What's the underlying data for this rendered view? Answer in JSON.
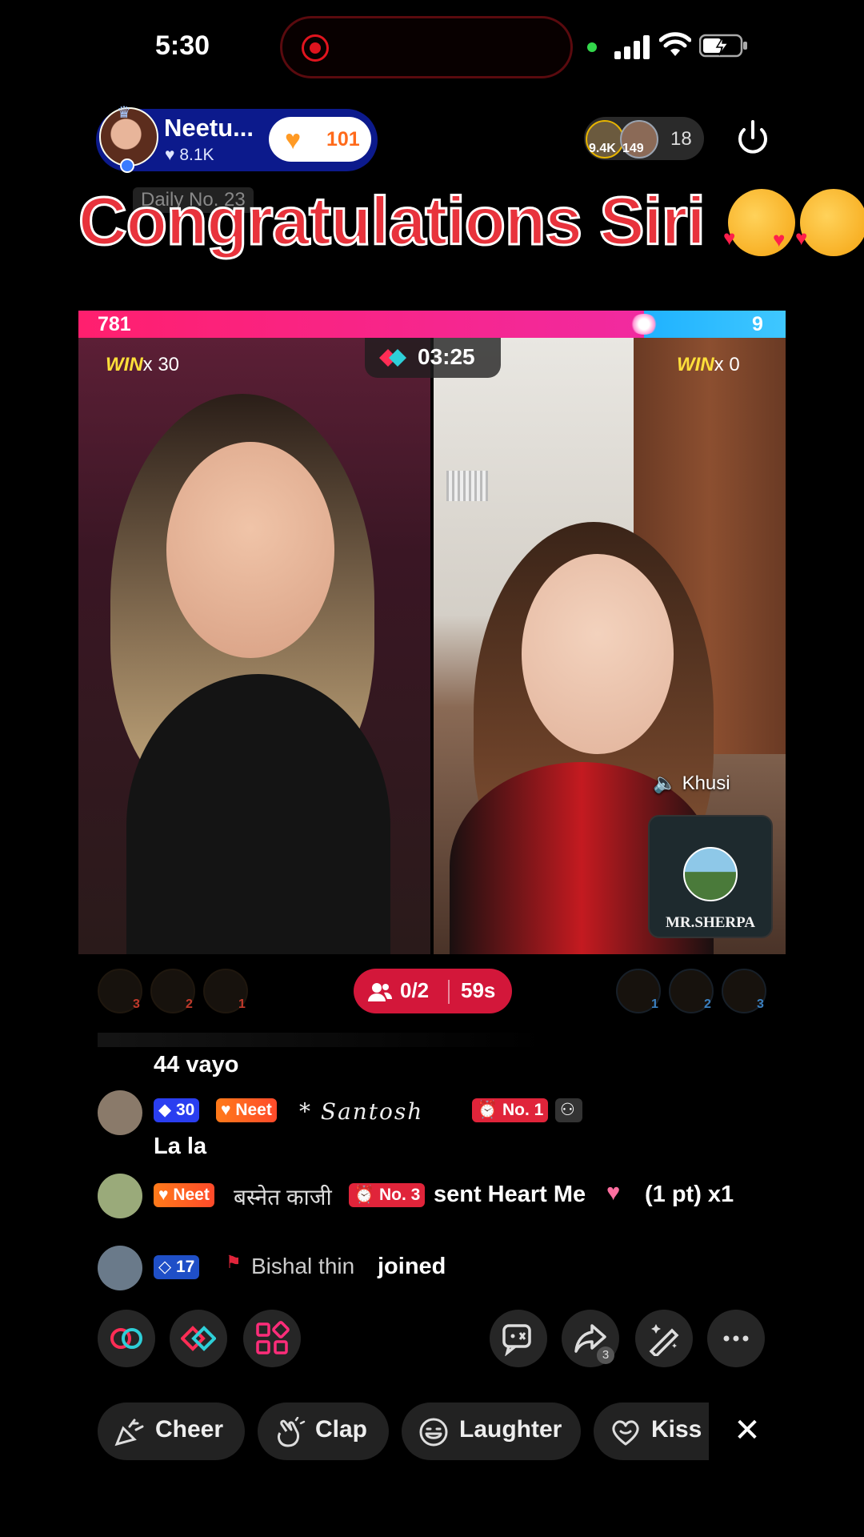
{
  "status_bar": {
    "time": "5:30"
  },
  "host": {
    "name": "Neetu...",
    "likes": "8.1K",
    "follow_count": "101"
  },
  "viewers": {
    "avatar1_count": "9.4K",
    "avatar2_count": "149",
    "total": "18"
  },
  "overlay": {
    "daily_label": "Daily No. 23",
    "congrats_text": "Congratulations Siri"
  },
  "battle": {
    "score_left": "781",
    "score_right": "9",
    "timer": "03:25",
    "left_win_label": "WIN",
    "left_win_count": "x 30",
    "right_win_label": "WIN",
    "right_win_count": "x 0",
    "right_mic_label": "Khusi",
    "guest_name": "MR.SHERPA",
    "progress_left_fraction": 0.8
  },
  "contributors": {
    "left_ranks": [
      "3",
      "2",
      "1"
    ],
    "right_ranks": [
      "1",
      "2",
      "3"
    ],
    "mic_seats": "0/2",
    "mic_time": "59s"
  },
  "chat": [
    {
      "id": "c1",
      "text": "44 vayo"
    },
    {
      "id": "c2",
      "level": "30",
      "fan_badge": "Neet",
      "user": "* Santosh",
      "rank_badge": "No. 1",
      "text": "La la"
    },
    {
      "id": "c3",
      "fan_badge": "Neet",
      "user": "बस्नेत काजी",
      "rank_badge": "No. 3",
      "text": "sent Heart Me",
      "gift_suffix": "(1 pt) x1"
    },
    {
      "id": "c4",
      "level": "17",
      "user": "Bishal thin",
      "text": "joined"
    }
  ],
  "reactions": [
    {
      "label": "Cheer"
    },
    {
      "label": "Clap"
    },
    {
      "label": "Laughter"
    },
    {
      "label": "Kiss"
    }
  ],
  "colors": {
    "accent_pink": "#ff1f6e",
    "accent_blue": "#1fb2ff",
    "congrats_red": "#e8333c",
    "win_yellow": "#ffdf3a",
    "mic_pill_red": "#d3173a"
  },
  "icons": [
    "record-icon",
    "signal-icon",
    "wifi-icon",
    "battery-icon",
    "power-icon",
    "heart-icon",
    "link-icon",
    "pk-icon",
    "apps-icon",
    "chat-icon",
    "share-icon",
    "magic-wand-icon",
    "more-icon",
    "cheer-icon",
    "clap-icon",
    "laughter-icon",
    "kiss-icon",
    "close-icon"
  ]
}
